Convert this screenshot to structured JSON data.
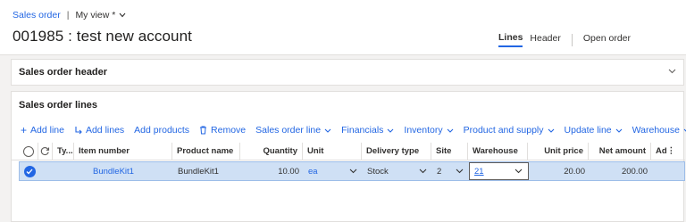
{
  "breadcrumb": {
    "link": "Sales order",
    "separator": "|",
    "view": "My view *"
  },
  "record_title": "001985 : test new account",
  "view_switch": {
    "tabs": [
      "Lines",
      "Header"
    ],
    "open_order": "Open order"
  },
  "header_fasttab": {
    "title": "Sales order header"
  },
  "lines_fasttab": {
    "title": "Sales order lines",
    "actions": [
      {
        "icon": "plus-icon",
        "label": "Add line"
      },
      {
        "icon": "add-lines-icon",
        "label": "Add lines"
      },
      {
        "icon": "",
        "label": "Add products"
      },
      {
        "icon": "trash-icon",
        "label": "Remove"
      },
      {
        "icon": "chevron-down-icon",
        "label": "Sales order line"
      },
      {
        "icon": "chevron-down-icon",
        "label": "Financials"
      },
      {
        "icon": "chevron-down-icon",
        "label": "Inventory"
      },
      {
        "icon": "chevron-down-icon",
        "label": "Product and supply"
      },
      {
        "icon": "chevron-down-icon",
        "label": "Update line"
      },
      {
        "icon": "chevron-down-icon",
        "label": "Warehouse"
      }
    ],
    "more": "···",
    "columns": [
      "Ty...",
      "Item number",
      "Product name",
      "Quantity",
      "Unit",
      "Delivery type",
      "Site",
      "Warehouse",
      "Unit price",
      "Net amount",
      "Ad"
    ],
    "rows": [
      {
        "item_number": "BundleKit1",
        "product_name": "BundleKit1",
        "quantity": "10.00",
        "unit": "ea",
        "delivery_type": "Stock",
        "site": "2",
        "warehouse": "21",
        "unit_price": "20.00",
        "net_amount": "200.00"
      }
    ]
  },
  "colors": {
    "accent": "#2266e3",
    "selected_row": "#cfe0f5"
  }
}
